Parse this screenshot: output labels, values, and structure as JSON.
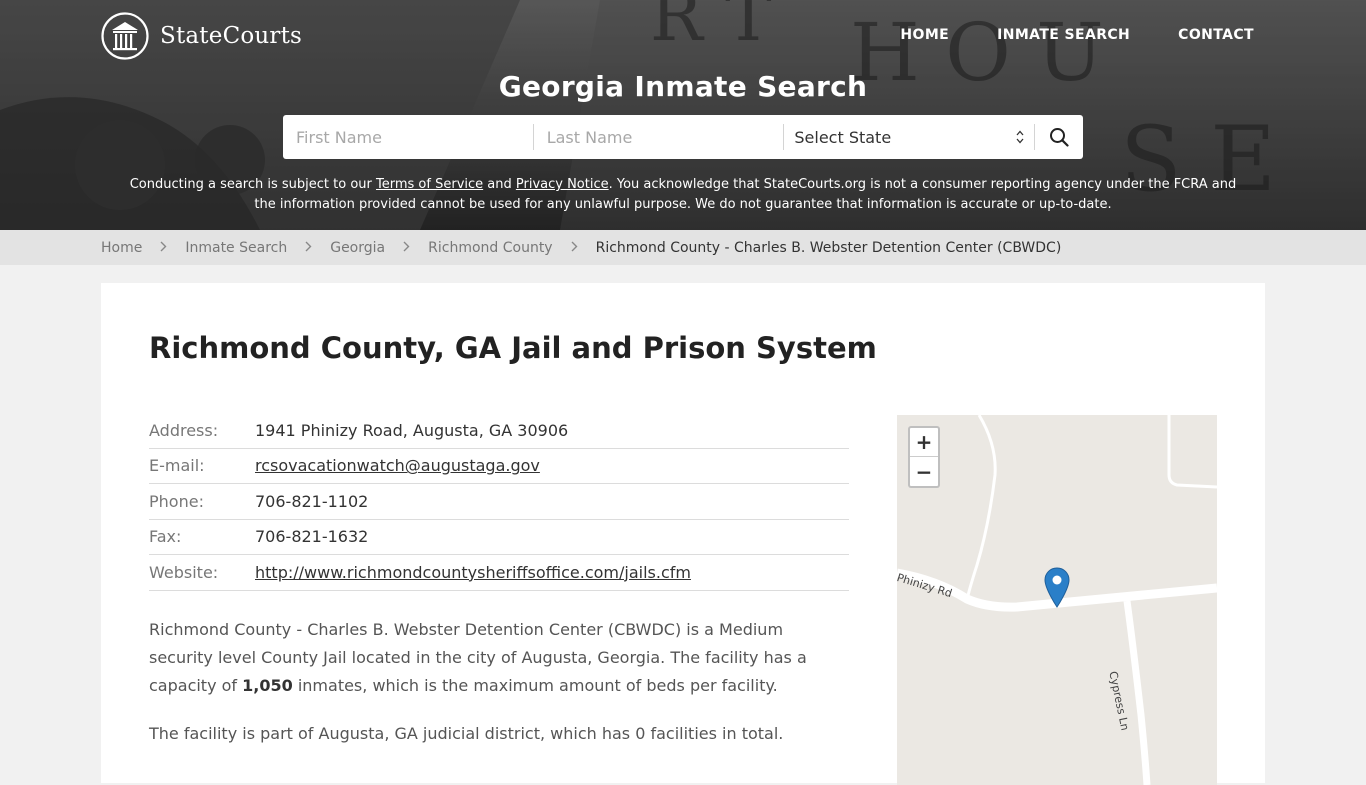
{
  "brand": {
    "name": "StateCourts"
  },
  "nav": [
    {
      "label": "HOME"
    },
    {
      "label": "INMATE SEARCH"
    },
    {
      "label": "CONTACT"
    }
  ],
  "hero": {
    "title": "Georgia Inmate Search",
    "search": {
      "first_name_placeholder": "First Name",
      "last_name_placeholder": "Last Name",
      "state_selected": "Select State"
    },
    "disclaimer": {
      "part1": "Conducting a search is subject to our ",
      "terms_link": "Terms of Service",
      "part2": " and ",
      "privacy_link": "Privacy Notice",
      "part3": ". You acknowledge that StateCourts.org is not a consumer reporting agency under the FCRA and the information provided cannot be used for any unlawful purpose. We do not guarantee that information is accurate or up-to-date."
    }
  },
  "breadcrumb": [
    {
      "label": "Home"
    },
    {
      "label": "Inmate Search"
    },
    {
      "label": "Georgia"
    },
    {
      "label": "Richmond County"
    },
    {
      "label": "Richmond County - Charles B. Webster Detention Center (CBWDC)"
    }
  ],
  "main": {
    "title": "Richmond County, GA Jail and Prison System",
    "info": {
      "address_label": "Address:",
      "address": "1941 Phinizy Road, Augusta, GA 30906",
      "email_label": "E-mail:",
      "email": "rcsovacationwatch@augustaga.gov",
      "phone_label": "Phone:",
      "phone": "706-821-1102",
      "fax_label": "Fax:",
      "fax": "706-821-1632",
      "website_label": "Website:",
      "website": "http://www.richmondcountysheriffsoffice.com/jails.cfm"
    },
    "description": {
      "part1": "Richmond County - Charles B. Webster Detention Center (CBWDC) is a Medium security level County Jail located in the city of Augusta, Georgia. The facility has a capacity of ",
      "capacity": "1,050",
      "part2": " inmates, which is the maximum amount of beds per facility."
    },
    "description2": "The facility is part of Augusta, GA judicial district, which has 0 facilities in total."
  },
  "map": {
    "zoom_in": "+",
    "zoom_out": "−",
    "road1": "Phinizy Rd",
    "road2": "Cypress Ln"
  },
  "colors": {
    "hero_text": "#ffffff",
    "marker": "#2a7fc8"
  }
}
